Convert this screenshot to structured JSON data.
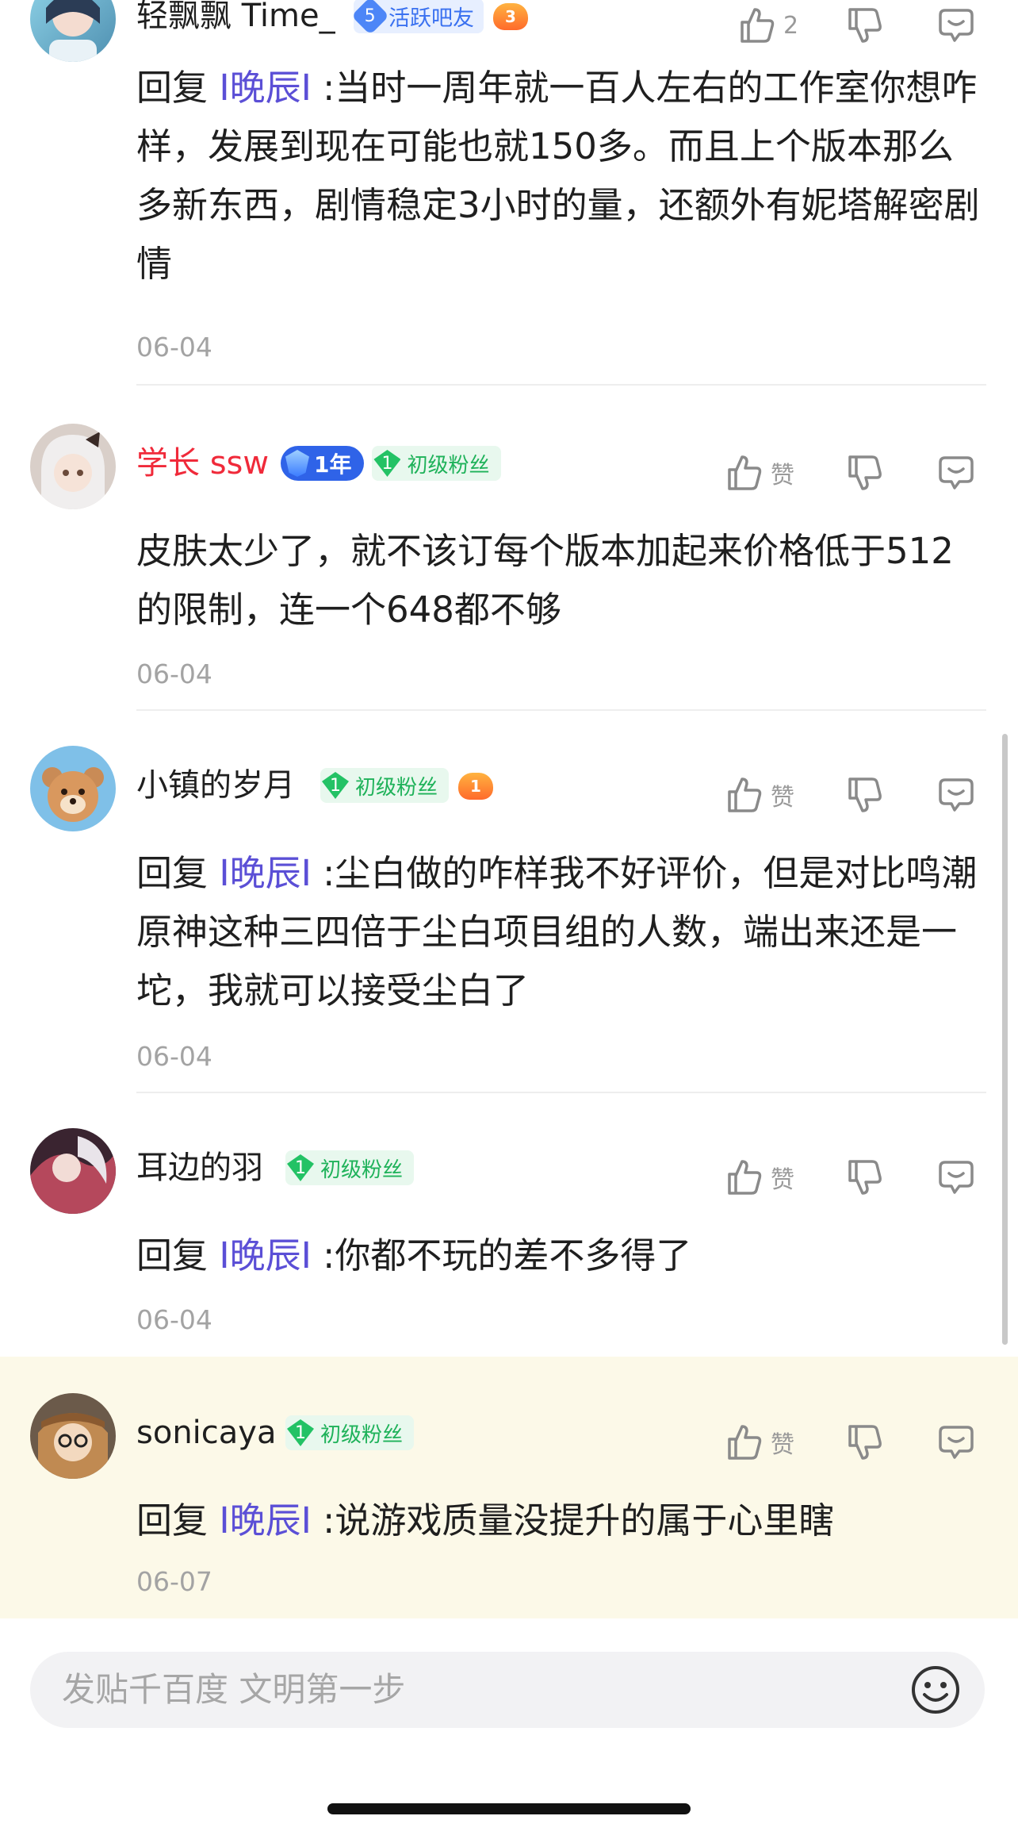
{
  "comments": [
    {
      "username": "轻飘飘 Time_",
      "active_badge": {
        "level": "5",
        "label": "活跃吧友"
      },
      "level_badge": "3",
      "like_label": "2",
      "reply_prefix": "回复 ",
      "mention": "I晚辰I",
      "text": " :当时一周年就一百人左右的工作室你想咋样，发展到现在可能也就150多。而且上个版本那么多新东西，剧情稳定3小时的量，还额外有妮塔解密剧情",
      "date": "06-04"
    },
    {
      "username": "学长 ssw",
      "year_badge": "1年",
      "fan_badge": {
        "level": "1",
        "label": "初级粉丝"
      },
      "like_label": "赞",
      "text": "皮肤太少了，就不该订每个版本加起来价格低于512的限制，连一个648都不够",
      "date": "06-04"
    },
    {
      "username": "小镇的岁月",
      "fan_badge": {
        "level": "1",
        "label": "初级粉丝"
      },
      "level_badge": "1",
      "like_label": "赞",
      "reply_prefix": "回复 ",
      "mention": "I晚辰I",
      "text": " :尘白做的咋样我不好评价，但是对比鸣潮原神这种三四倍于尘白项目组的人数，端出来还是一坨，我就可以接受尘白了",
      "date": "06-04"
    },
    {
      "username": "耳边的羽",
      "fan_badge": {
        "level": "1",
        "label": "初级粉丝"
      },
      "like_label": "赞",
      "reply_prefix": "回复 ",
      "mention": "I晚辰I",
      "text": " :你都不玩的差不多得了",
      "date": "06-04"
    },
    {
      "username": "sonicaya",
      "fan_badge": {
        "level": "1",
        "label": "初级粉丝"
      },
      "like_label": "赞",
      "reply_prefix": "回复 ",
      "mention": "I晚辰I",
      "text": " :说游戏质量没提升的属于心里瞎",
      "date": "06-07"
    }
  ],
  "composer": {
    "placeholder": "发贴千百度 文明第一步"
  },
  "colors": {
    "mention": "#5b4fd6",
    "highlight_bg": "#fcf9e8",
    "red_name": "#f02a3a"
  },
  "icons": [
    "thumb-up-icon",
    "thumb-down-icon",
    "reply-icon",
    "emoji-icon"
  ]
}
